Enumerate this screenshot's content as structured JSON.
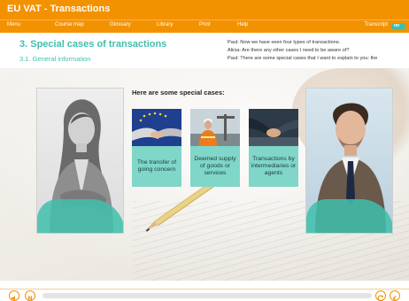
{
  "app": {
    "title": "EU VAT - Transactions"
  },
  "menu": {
    "items": [
      "Menu",
      "Course map",
      "Glossary",
      "Library",
      "Print",
      "Help"
    ],
    "transcript_label": "Transcript",
    "transcript_toggle": "on"
  },
  "header": {
    "chapter": "3. Special cases of transactions",
    "section": "3.1. General information"
  },
  "transcript": {
    "lines": [
      "Paul: Now we have seen four types of transactions.",
      "Alicia: Are there any other cases I need to be aware of?",
      "Paul: There are some special cases that I want to explain to you: the"
    ]
  },
  "stage": {
    "heading": "Here are some special cases:",
    "cases": [
      {
        "label": "The transfer of going concern",
        "image": "handshake-eu-flag"
      },
      {
        "label": "Deemed supply of goods or services",
        "image": "construction-worker"
      },
      {
        "label": "Transactions by intermediaries or agents",
        "image": "handshake-business"
      }
    ],
    "people": [
      "businesswoman-alicia",
      "businessman-paul"
    ]
  },
  "player": {
    "progress": 0.0
  },
  "colors": {
    "accent": "#f39200",
    "teal": "#3fbfad",
    "card": "#7fd6c9"
  }
}
